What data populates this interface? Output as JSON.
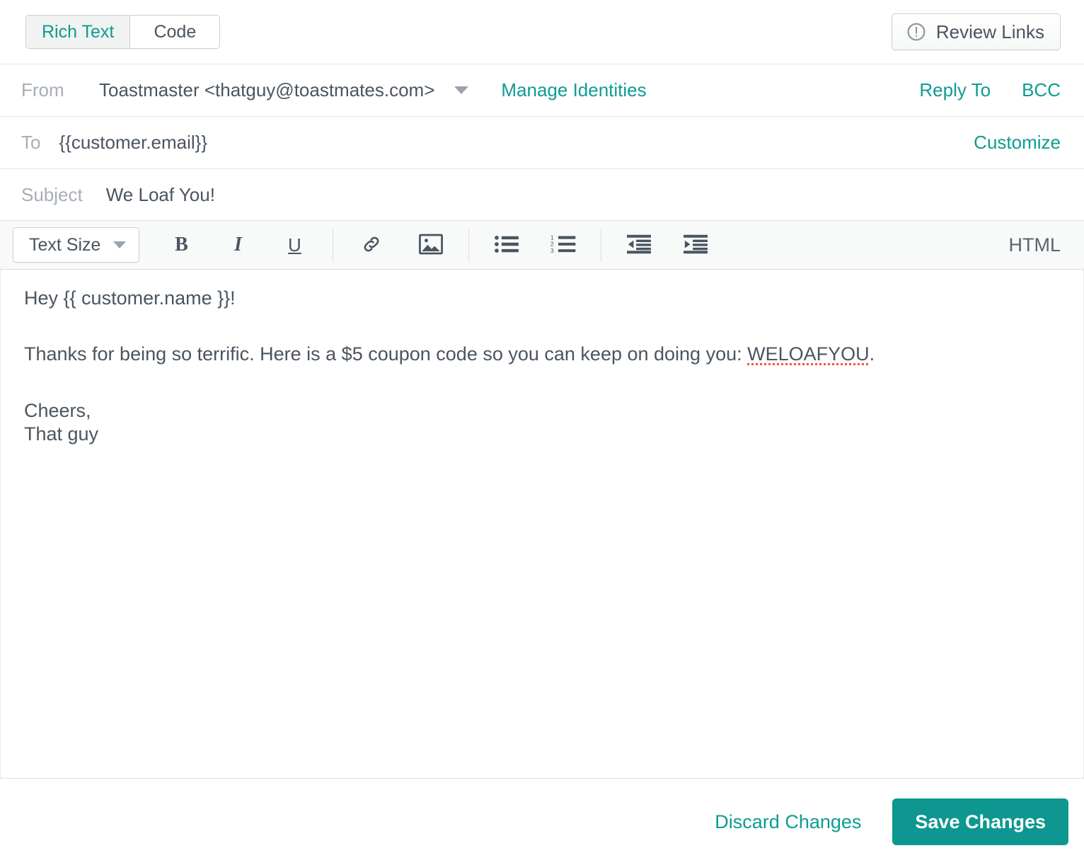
{
  "topbar": {
    "tabs": [
      {
        "label": "Rich Text",
        "active": true
      },
      {
        "label": "Code",
        "active": false
      }
    ],
    "review_links_label": "Review Links",
    "review_icon": "exclamation-circle-icon"
  },
  "header": {
    "from_label": "From",
    "from_value": "Toastmaster <thatguy@toastmates.com>",
    "manage_identities_label": "Manage Identities",
    "reply_to_label": "Reply To",
    "bcc_label": "BCC",
    "to_label": "To",
    "to_value": "{{customer.email}}",
    "customize_label": "Customize",
    "subject_label": "Subject",
    "subject_value": "We Loaf You!"
  },
  "toolbar": {
    "text_size_label": "Text Size",
    "bold_label": "B",
    "italic_label": "I",
    "underline_label": "U",
    "link_icon": "link-icon",
    "image_icon": "image-icon",
    "bullet_list_icon": "bullet-list-icon",
    "numbered_list_icon": "numbered-list-icon",
    "outdent_icon": "outdent-icon",
    "indent_icon": "indent-icon",
    "html_label": "HTML"
  },
  "body": {
    "greeting": "Hey {{ customer.name }}!",
    "paragraph_before_code": "Thanks for being so terrific. Here is a $5 coupon code so you can keep on doing you: ",
    "coupon_code": "WELOAFYOU",
    "paragraph_after_code": ".",
    "signoff": "Cheers,",
    "signature": "That guy"
  },
  "footer": {
    "discard_label": "Discard Changes",
    "save_label": "Save Changes"
  },
  "colors": {
    "accent_teal": "#0d9c92",
    "save_button_bg": "#0d9790",
    "text_primary": "#4a5560",
    "text_muted": "#a7aeb5",
    "border": "#e2e4e6",
    "toolbar_bg": "#f8f9f9",
    "spellcheck_red": "#fb4d3d"
  }
}
